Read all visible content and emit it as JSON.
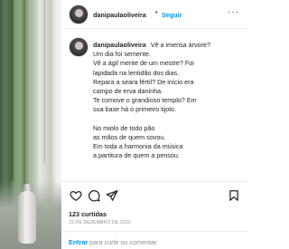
{
  "post": {
    "username": "danipaulaoliveira",
    "follow_label": "Seguir",
    "separator": "•",
    "more_label": "···",
    "caption_first_line": "Vê a imensa árvore?",
    "caption_lines": [
      "Um dia foi semente.",
      "Vê a ágil mente de um mestre? Foi",
      "lapidada na lentidão dos dias.",
      "Repara a seara fértil? De início era",
      "campo de erva daninha.",
      "Te comove o grandioso templo? Em",
      "sua base há o primeiro tijolo."
    ],
    "caption_lines_2": [
      "No miolo de todo pão",
      "as mãos de quem sovou.",
      "Em toda a harmonia da música",
      "a partitura de quem a pensou."
    ],
    "likes": "123 curtidas",
    "date": "23 DE DEZEMBRO DE 2022",
    "comment_link": "Entrar",
    "comment_prompt": "para curtir ou comentar."
  },
  "icons": {
    "like": "heart-icon",
    "comment": "comment-icon",
    "share": "share-icon",
    "save": "bookmark-icon"
  },
  "colors": {
    "accent": "#0095f6",
    "text": "#262626",
    "muted": "#8e8e8e",
    "border": "#efefef"
  }
}
